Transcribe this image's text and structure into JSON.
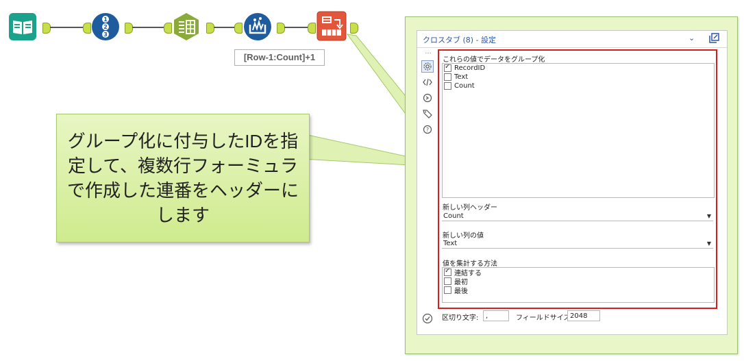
{
  "workflow": {
    "formula_expression": "[Row-1:Count]+1"
  },
  "callout": {
    "text": "グループ化に付与したIDを指定して、複数行フォーミュラで作成した連番をヘッダーにします"
  },
  "panel": {
    "title": "クロスタブ (8) - 設定",
    "group_by_label": "これらの値でデータをグループ化",
    "group_by_fields": [
      {
        "label": "RecordID",
        "checked": true
      },
      {
        "label": "Text",
        "checked": false
      },
      {
        "label": "Count",
        "checked": false
      }
    ],
    "header_label": "新しい列ヘッダー",
    "header_value": "Count",
    "values_label": "新しい列の値",
    "values_value": "Text",
    "method_label": "値を集計する方法",
    "methods": [
      {
        "label": "連結する",
        "checked": true
      },
      {
        "label": "最初",
        "checked": false
      },
      {
        "label": "最後",
        "checked": false
      }
    ],
    "separator_label": "区切り文字:",
    "separator_value": ",",
    "field_size_label": "フィールドサイズ:",
    "field_size_value": "2048"
  },
  "colors": {
    "book_tool": "#1aa38a",
    "record_id_tool": "#1f5c9e",
    "select_tool": "#8aab3a",
    "multirow_tool": "#1f5c9e",
    "crosstab_tool": "#e2563c",
    "highlight_border": "#d91c1c",
    "callout_fill": "#d8f0a8"
  },
  "icons": [
    "book-icon",
    "numbered-list-icon",
    "select-records-icon",
    "multirow-formula-icon",
    "crosstab-icon",
    "gear-icon",
    "code-icon",
    "refresh-icon",
    "tag-icon",
    "help-icon",
    "check-circle-icon",
    "chevron-down-icon",
    "undock-icon"
  ]
}
